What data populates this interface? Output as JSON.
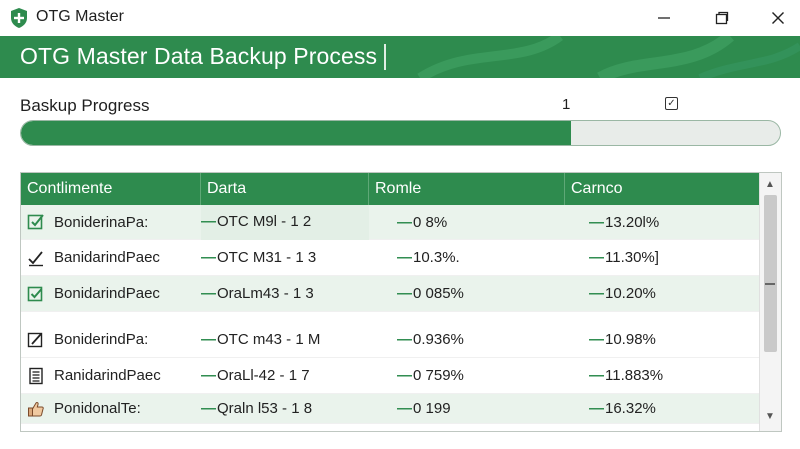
{
  "window": {
    "app_title": "OTG Master",
    "brand_color": "#2e8b4e"
  },
  "header": {
    "title": "OTG Master Data Backup Process"
  },
  "progress": {
    "label": "Baskup Progress",
    "count": "1",
    "check_glyph": "✓",
    "fraction": 0.725
  },
  "table": {
    "columns": [
      "Contlimente",
      "Darta",
      "Romle",
      "Carnco"
    ],
    "rows": [
      {
        "icon": "edit-check-icon",
        "name": "BoniderinaPa:",
        "code": "OTC M9l - 1 2",
        "rate": "0 8%",
        "change": "13.20l%"
      },
      {
        "icon": "check-pencil-icon",
        "name": "BanidarindPaec",
        "code": "OTC M31 - 1 3",
        "rate": "10.3%.",
        "change": "11.30%]"
      },
      {
        "icon": "check-box-icon",
        "name": "BonidarindPaec",
        "code": "OraLm43 - 1 3",
        "rate": "0 085%",
        "change": "10.20%"
      },
      {
        "icon": "edit-box-icon",
        "name": "BoniderindPa:",
        "code": "OTC m43 - 1 M",
        "rate": "0.936%",
        "change": "10.98%"
      },
      {
        "icon": "document-list-icon",
        "name": "RanidarindPaec",
        "code": "OraLl-42 - 1 7",
        "rate": "0 759%",
        "change": "11.883%"
      },
      {
        "icon": "thumbs-up-icon",
        "name": "PonidonalTe:",
        "code": "Qraln l53 - 1 8",
        "rate": "0 199",
        "change": "16.32%"
      }
    ]
  }
}
